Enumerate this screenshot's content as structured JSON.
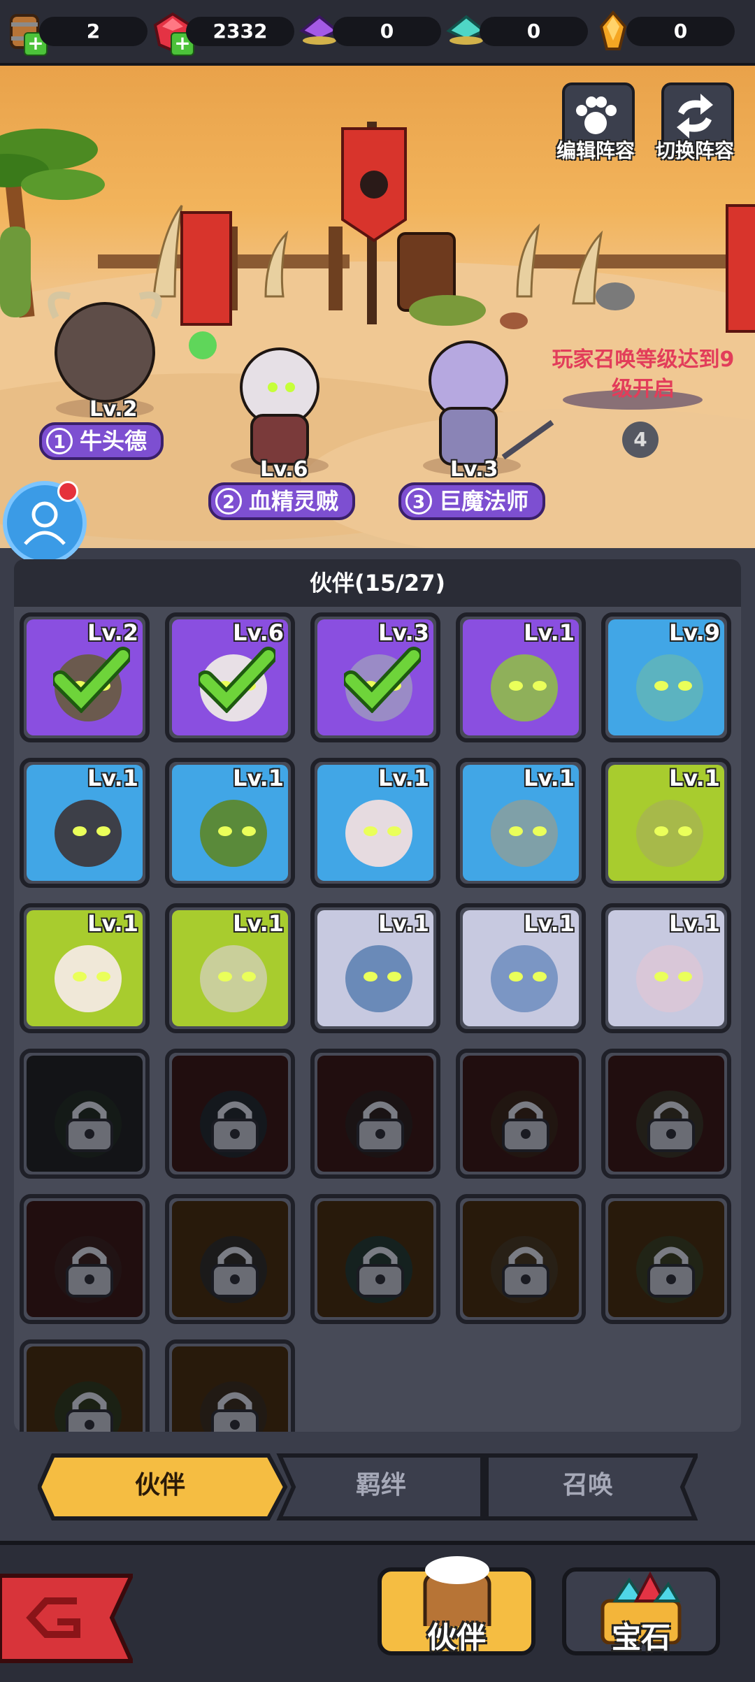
{
  "resources": [
    {
      "name": "beer-barrel",
      "value": "2",
      "has_plus": true
    },
    {
      "name": "red-gem",
      "value": "2332",
      "has_plus": true
    },
    {
      "name": "purple-crystal",
      "value": "0",
      "has_plus": false
    },
    {
      "name": "teal-crystal",
      "value": "0",
      "has_plus": false
    },
    {
      "name": "orange-crystal",
      "value": "0",
      "has_plus": false
    }
  ],
  "scene": {
    "edit_lineup_label": "编辑阵容",
    "switch_lineup_label": "切换阵容",
    "locked_message": "玩家召唤等级达到9级开启",
    "slot4_number": "4",
    "heroes": [
      {
        "slot": "1",
        "name": "牛头德",
        "level": "Lv.2"
      },
      {
        "slot": "2",
        "name": "血精灵贼",
        "level": "Lv.6"
      },
      {
        "slot": "3",
        "name": "巨魔法师",
        "level": "Lv.3"
      }
    ]
  },
  "panel": {
    "title": "伙伴(15/27)",
    "cards": [
      {
        "level": "Lv.2",
        "rarity": "purple",
        "selected": true,
        "face": "#6b5a4e"
      },
      {
        "level": "Lv.6",
        "rarity": "purple",
        "selected": true,
        "face": "#e8e0e6"
      },
      {
        "level": "Lv.3",
        "rarity": "purple",
        "selected": true,
        "face": "#9a8bc6"
      },
      {
        "level": "Lv.1",
        "rarity": "purple",
        "selected": false,
        "face": "#8fb05a"
      },
      {
        "level": "Lv.9",
        "rarity": "blue",
        "selected": false,
        "face": "#5cb3c0"
      },
      {
        "level": "Lv.1",
        "rarity": "blue",
        "selected": false,
        "face": "#3d3f48"
      },
      {
        "level": "Lv.1",
        "rarity": "blue",
        "selected": false,
        "face": "#5a8a3a"
      },
      {
        "level": "Lv.1",
        "rarity": "blue",
        "selected": false,
        "face": "#e6dbe0"
      },
      {
        "level": "Lv.1",
        "rarity": "blue",
        "selected": false,
        "face": "#7fa0a8"
      },
      {
        "level": "Lv.1",
        "rarity": "green",
        "selected": false,
        "face": "#a7b94a"
      },
      {
        "level": "Lv.1",
        "rarity": "green",
        "selected": false,
        "face": "#f0e8d8"
      },
      {
        "level": "Lv.1",
        "rarity": "green",
        "selected": false,
        "face": "#c9cf9a"
      },
      {
        "level": "Lv.1",
        "rarity": "white",
        "selected": false,
        "face": "#6a8ab8"
      },
      {
        "level": "Lv.1",
        "rarity": "white",
        "selected": false,
        "face": "#7b96c4"
      },
      {
        "level": "Lv.1",
        "rarity": "white",
        "selected": false,
        "face": "#d9c7d8"
      },
      {
        "level": "",
        "rarity": "locked-dark",
        "selected": false,
        "face": "#2c3a33"
      },
      {
        "level": "",
        "rarity": "locked-red",
        "selected": false,
        "face": "#2d3540"
      },
      {
        "level": "",
        "rarity": "locked-red",
        "selected": false,
        "face": "#3a2a2c"
      },
      {
        "level": "",
        "rarity": "locked-red",
        "selected": false,
        "face": "#4a3226"
      },
      {
        "level": "",
        "rarity": "locked-red",
        "selected": false,
        "face": "#4a4236"
      },
      {
        "level": "",
        "rarity": "locked-red",
        "selected": false,
        "face": "#4a2a2c"
      },
      {
        "level": "",
        "rarity": "locked-orange",
        "selected": false,
        "face": "#3c3a3a"
      },
      {
        "level": "",
        "rarity": "locked-orange",
        "selected": false,
        "face": "#2e4a44"
      },
      {
        "level": "",
        "rarity": "locked-orange",
        "selected": false,
        "face": "#5a4630"
      },
      {
        "level": "",
        "rarity": "locked-orange",
        "selected": false,
        "face": "#4a5030"
      },
      {
        "level": "",
        "rarity": "locked-orange",
        "selected": false,
        "face": "#3c4a2c"
      },
      {
        "level": "",
        "rarity": "locked-orange",
        "selected": false,
        "face": "#4a3a2c"
      }
    ]
  },
  "tabs": [
    {
      "label": "伙伴",
      "active": true
    },
    {
      "label": "羁绊",
      "active": false
    },
    {
      "label": "召唤",
      "active": false
    }
  ],
  "bottom_nav": {
    "partner_label": "伙伴",
    "gem_label": "宝石"
  },
  "colors": {
    "purple": "#8a4fe0",
    "blue": "#41a6e6",
    "green": "#a8cc2e",
    "white": "#c7c9e0",
    "locked-dark": "#2a2c34",
    "locked-red": "#4a1e22",
    "locked-orange": "#5a3a18",
    "tab_active": "#f5bd42"
  }
}
